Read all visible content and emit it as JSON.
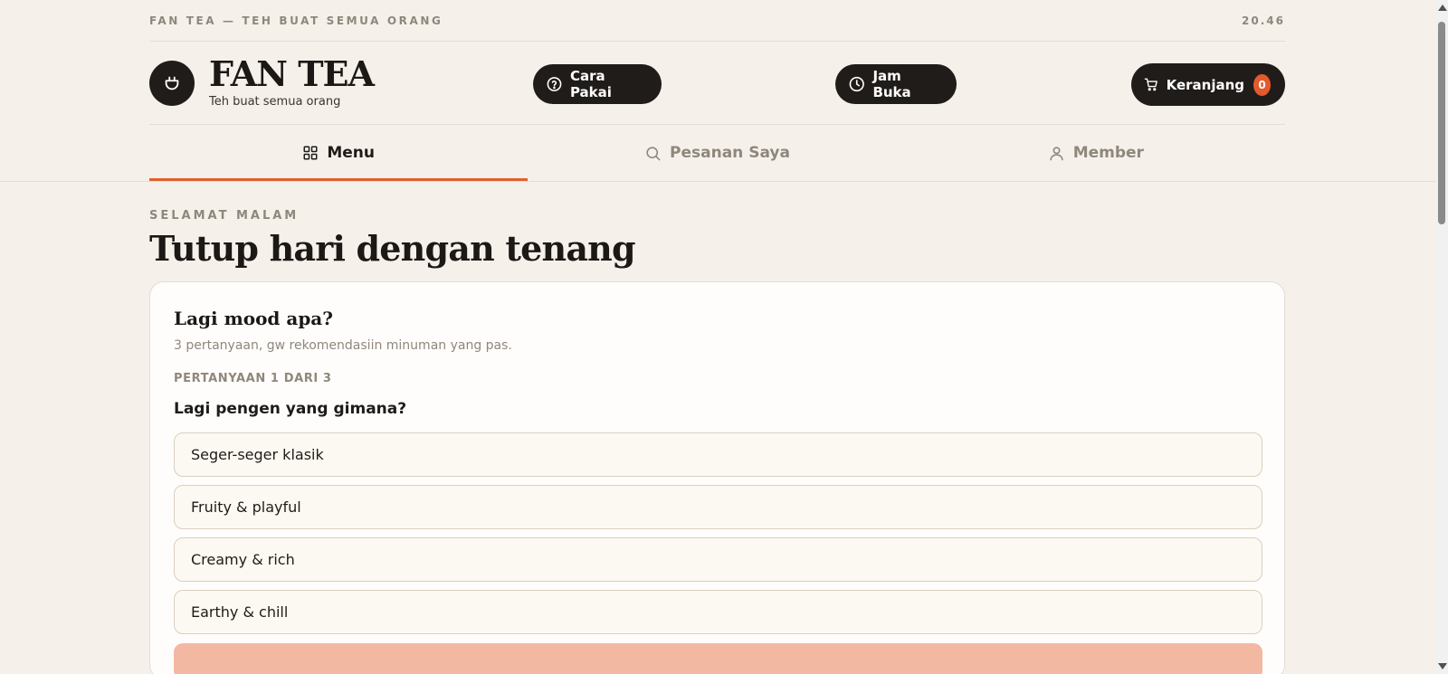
{
  "topbar": {
    "tagline": "FAN TEA — TEH BUAT SEMUA ORANG",
    "time": "20.46"
  },
  "brand": {
    "name": "FAN TEA",
    "tagline": "Teh buat semua orang",
    "logo_icon": "cup-icon"
  },
  "header_buttons": {
    "help": {
      "label": "Cara Pakai",
      "icon": "question-circle-icon"
    },
    "hours": {
      "label": "Jam Buka",
      "icon": "clock-icon"
    },
    "cart": {
      "label": "Keranjang",
      "icon": "cart-icon",
      "count": "0"
    }
  },
  "tabs": [
    {
      "label": "Menu",
      "icon": "grid-icon",
      "active": true
    },
    {
      "label": "Pesanan Saya",
      "icon": "search-icon",
      "active": false
    },
    {
      "label": "Member",
      "icon": "user-icon",
      "active": false
    }
  ],
  "greeting": {
    "kicker": "SELAMAT MALAM",
    "title": "Tutup hari dengan tenang"
  },
  "quiz": {
    "title": "Lagi mood apa?",
    "subtitle": "3 pertanyaan, gw rekomendasiin minuman yang pas.",
    "progress": "PERTANYAAN 1 DARI 3",
    "question": "Lagi pengen yang gimana?",
    "options": [
      "Seger-seger klasik",
      "Fruity & playful",
      "Creamy & rich",
      "Earthy & chill"
    ]
  },
  "colors": {
    "accent": "#e0612f",
    "dark": "#201c19",
    "background": "#f5f1ea",
    "button_disabled": "#f3b8a2"
  }
}
